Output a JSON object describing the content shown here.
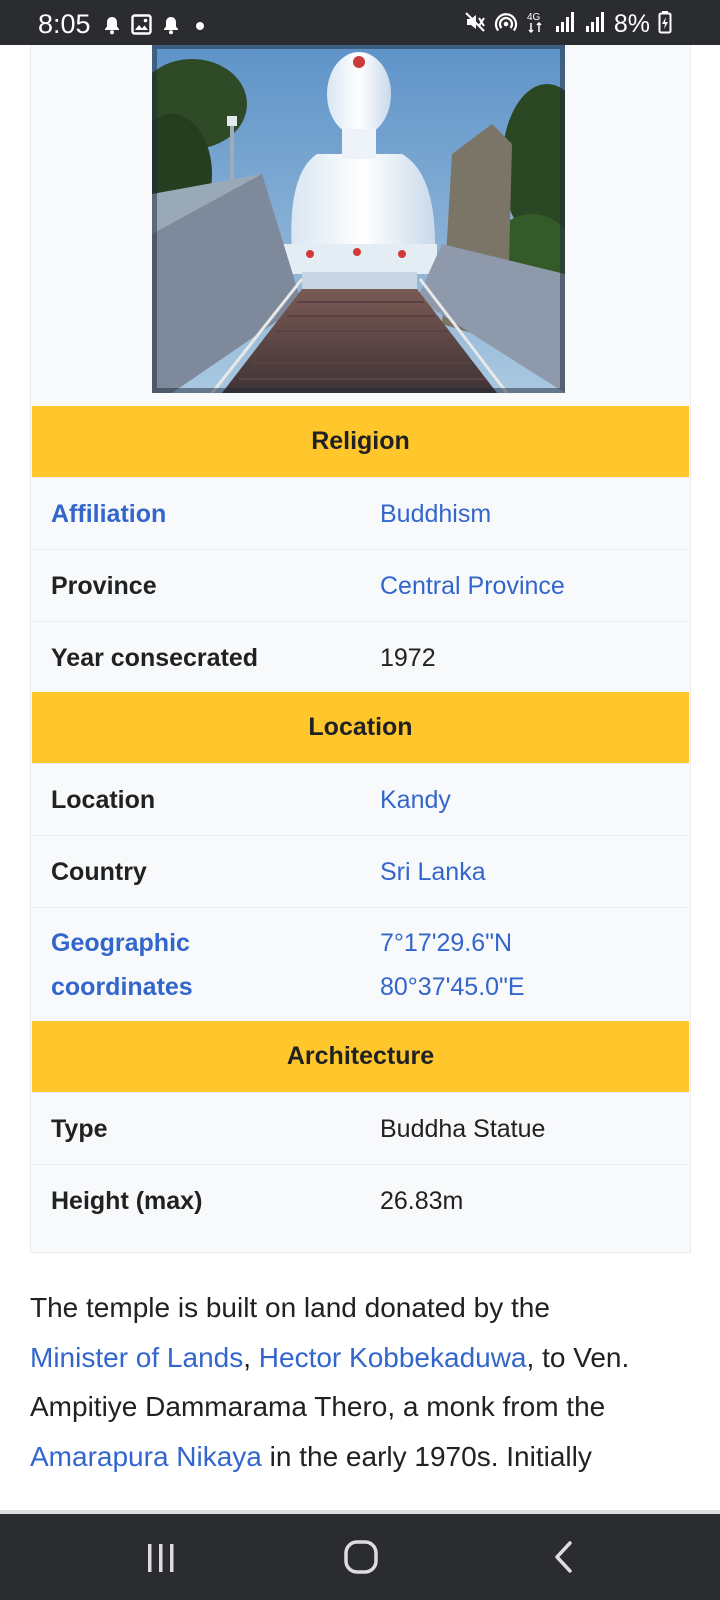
{
  "status_bar": {
    "time": "8:05",
    "battery": "8%",
    "network": "4G",
    "left_icons": [
      "notification-bell-icon",
      "image-icon",
      "notification-bell-icon",
      "dot-icon"
    ],
    "right_icons": [
      "mute-icon",
      "hotspot-icon",
      "network-4g-icon",
      "signal-icon",
      "signal-icon",
      "battery-icon"
    ]
  },
  "infobox": {
    "image_alt": "Bahiravokanda Vihara Buddha Statue",
    "sections": [
      {
        "header": "Religion",
        "rows": [
          {
            "label": "Affiliation",
            "value": "Buddhism"
          },
          {
            "label": "Province",
            "value": "Central Province"
          },
          {
            "label": "Year consecrated",
            "value": "1972"
          }
        ]
      },
      {
        "header": "Location",
        "rows": [
          {
            "label": "Location",
            "value": "Kandy"
          },
          {
            "label": "Country",
            "value": "Sri Lanka"
          },
          {
            "label": "Geographic coordinates",
            "label_line1": "Geographic",
            "label_line2": "coordinates",
            "value_line1": "7°17'29.6\"N",
            "value_line2": "80°37'45.0\"E"
          }
        ]
      },
      {
        "header": "Architecture",
        "rows": [
          {
            "label": "Type",
            "value": "Buddha Statue"
          },
          {
            "label": "Height (max)",
            "value": "26.83m"
          }
        ]
      }
    ]
  },
  "article": {
    "p1_text1": "The temple is built on land donated by the",
    "p1_link1": "Minister of Lands",
    "p1_sep": ",",
    "p1_link2": "Hector Kobbekaduwa",
    "p1_text2": ", to Ven.",
    "p1_text3": "Ampitiye Dammarama Thero, a monk from the",
    "p1_link3": "Amarapura Nikaya",
    "p1_text4": " in the early 1970s. Initially"
  },
  "nav_bar": {
    "buttons": [
      "recent-apps-icon",
      "home-icon",
      "back-icon"
    ]
  },
  "colors": {
    "section_header_bg": "#ffc72c",
    "link": "#3366cc",
    "infobox_bg": "#f8f9fa",
    "system_bar_bg": "#2b2c2f"
  }
}
